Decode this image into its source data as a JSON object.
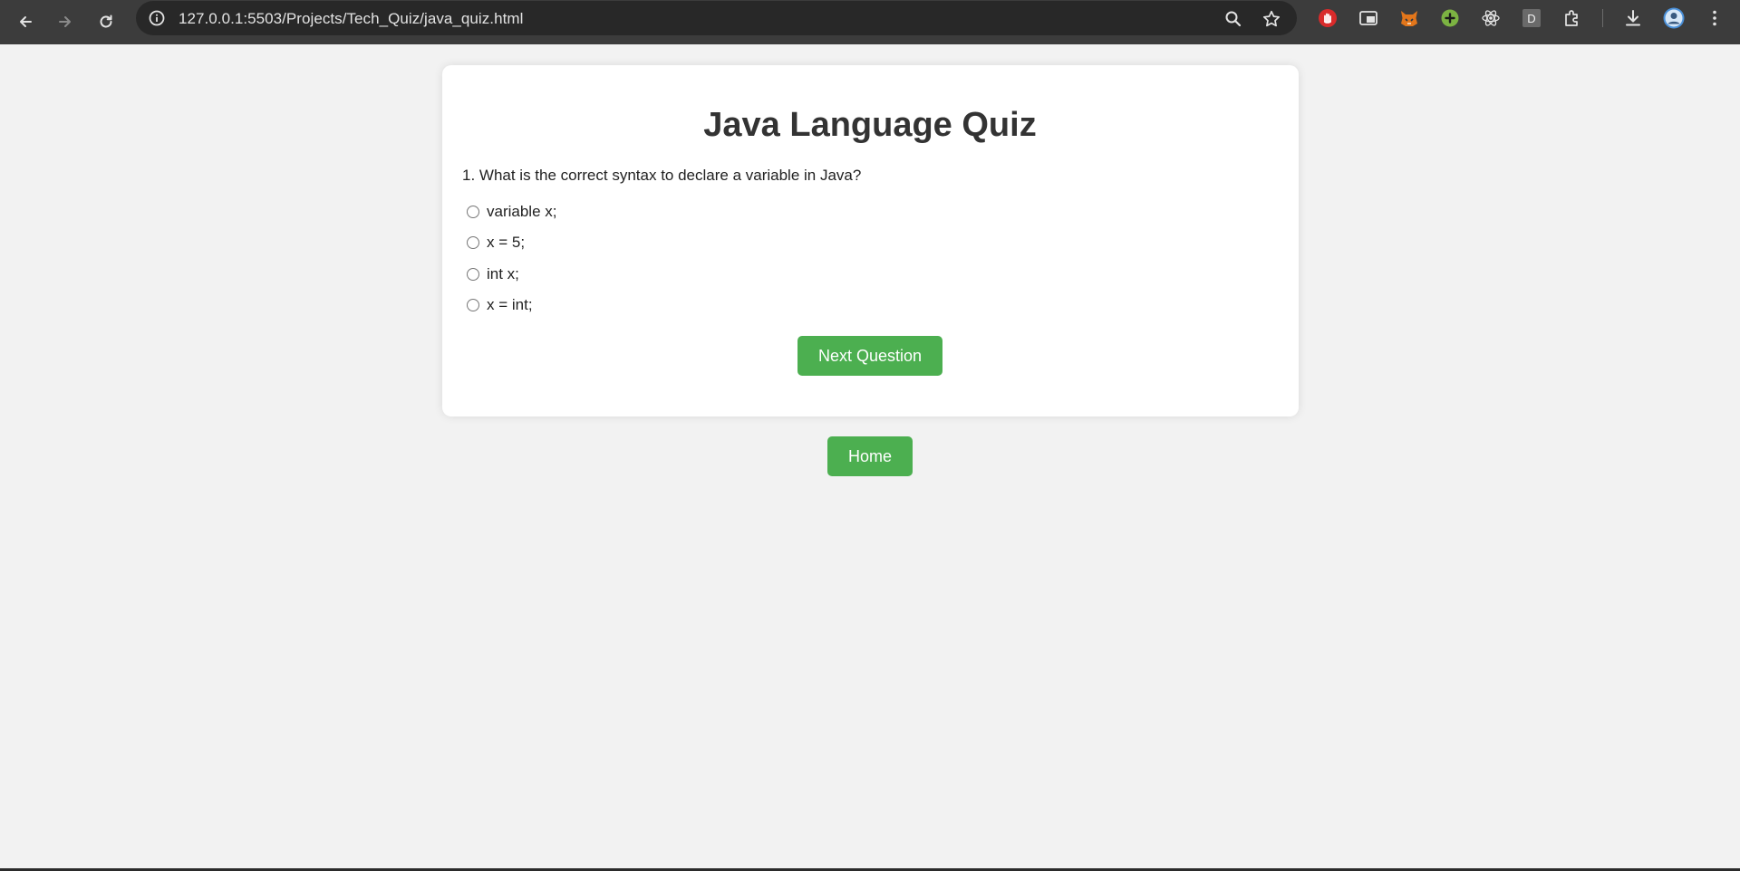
{
  "browser": {
    "url": "127.0.0.1:5503/Projects/Tech_Quiz/java_quiz.html",
    "back_icon": "arrow-left-icon",
    "forward_icon": "arrow-right-icon",
    "reload_icon": "reload-icon",
    "site_info_icon": "info-icon",
    "zoom_icon": "magnifier-icon",
    "bookmark_icon": "star-icon",
    "extensions": [
      "hand-stop-icon",
      "picture-in-picture-icon",
      "fox-icon",
      "plus-circle-icon",
      "react-atom-icon",
      "letter-d-icon",
      "puzzle-icon"
    ],
    "extension_d_letter": "D",
    "download_icon": "download-icon",
    "profile_icon": "avatar-icon",
    "menu_icon": "kebab-menu-icon"
  },
  "quiz": {
    "title": "Java Language Quiz",
    "question": "1. What is the correct syntax to declare a variable in Java?",
    "options": [
      "variable x;",
      "x = 5;",
      "int x;",
      "x = int;"
    ],
    "next_button": "Next Question"
  },
  "home_button": "Home",
  "colors": {
    "accent": "#4caf50",
    "page_background": "#f2f2f2",
    "card_background": "#ffffff",
    "title_text": "#333333",
    "chrome_background": "#3c3c3c"
  }
}
